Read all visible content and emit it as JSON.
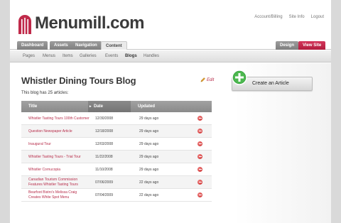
{
  "brand": {
    "name": "Menumill.com",
    "accent": "#c02a4a"
  },
  "top_links": [
    "Account/Billing",
    "Site Info",
    "Logout"
  ],
  "main_tabs": [
    {
      "label": "Dashboard"
    },
    {
      "label": "Assets"
    },
    {
      "label": "Navigation"
    },
    {
      "label": "Content",
      "active": true
    }
  ],
  "right_tabs": [
    {
      "label": "Design"
    },
    {
      "label": "View Site"
    }
  ],
  "sub_tabs": [
    {
      "label": "Pages"
    },
    {
      "label": "Menus"
    },
    {
      "label": "Items"
    },
    {
      "label": "Galleries"
    },
    {
      "label": "Events"
    },
    {
      "label": "Blogs",
      "active": true
    },
    {
      "label": "Handles"
    }
  ],
  "blog": {
    "title": "Whistler Dining Tours Blog",
    "edit_label": "Edit",
    "count_text": "This blog has 25 articles:"
  },
  "table": {
    "headers": [
      "Title",
      "Date",
      "Updated"
    ],
    "rows": [
      {
        "title": "Whistler Tasting Tours 100th Customer",
        "date": "12/30/2008",
        "updated": "29 days ago"
      },
      {
        "title": "Question Newspaper Article",
        "date": "12/18/2008",
        "updated": "29 days ago"
      },
      {
        "title": "Inaugural Tour",
        "date": "12/03/2008",
        "updated": "29 days ago"
      },
      {
        "title": "Whistler Tasting Tours - Trial Tour",
        "date": "11/22/2008",
        "updated": "29 days ago"
      },
      {
        "title": "Whistler Cornucopia",
        "date": "11/10/2008",
        "updated": "29 days ago"
      },
      {
        "title": "Canadian Tourism Commission Features Whistler Tasting Tours",
        "date": "07/06/2009",
        "updated": "22 days ago"
      },
      {
        "title": "Bearfoot Bistro's Melissa Craig Creates White Spot Menu",
        "date": "07/04/2009",
        "updated": "22 days ago"
      }
    ]
  },
  "create_button": {
    "label": "Create an Article"
  }
}
